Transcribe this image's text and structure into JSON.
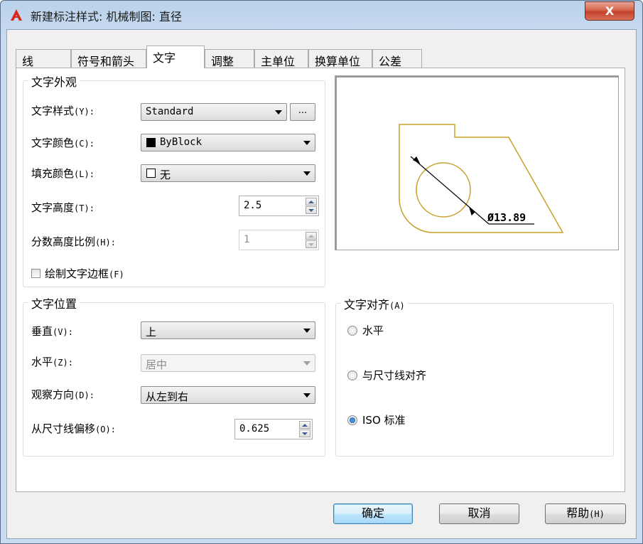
{
  "window": {
    "title": "新建标注样式: 机械制图: 直径",
    "close_label": "X"
  },
  "tabs": [
    {
      "label": "线"
    },
    {
      "label": "符号和箭头"
    },
    {
      "label": "文字"
    },
    {
      "label": "调整"
    },
    {
      "label": "主单位"
    },
    {
      "label": "换算单位"
    },
    {
      "label": "公差"
    }
  ],
  "active_tab": "文字",
  "text_appearance": {
    "title": "文字外观",
    "style_label": "文字样式",
    "style_key": "(Y):",
    "style_value": "Standard",
    "style_browse": "...",
    "color_label": "文字颜色",
    "color_key": "(C):",
    "color_value": "ByBlock",
    "fill_label": "填充颜色",
    "fill_key": "(L):",
    "fill_value": "无",
    "height_label": "文字高度",
    "height_key": "(T):",
    "height_value": "2.5",
    "fraction_label": "分数高度比例",
    "fraction_key": "(H):",
    "fraction_value": "1",
    "frame_label": "绘制文字边框",
    "frame_key": "(F)",
    "frame_checked": false
  },
  "text_placement": {
    "title": "文字位置",
    "vertical_label": "垂直",
    "vertical_key": "(V):",
    "vertical_value": "上",
    "horizontal_label": "水平",
    "horizontal_key": "(Z):",
    "horizontal_value": "居中",
    "view_dir_label": "观察方向",
    "view_dir_key": "(D):",
    "view_dir_value": "从左到右",
    "offset_label": "从尺寸线偏移",
    "offset_key": "(O):",
    "offset_value": "0.625"
  },
  "text_alignment": {
    "title": "文字对齐",
    "title_key": "(A)",
    "options": [
      {
        "label": "水平",
        "selected": false
      },
      {
        "label": "与尺寸线对齐",
        "selected": false
      },
      {
        "label": "ISO 标准",
        "selected": true
      }
    ]
  },
  "preview": {
    "dimension_text": "Ø13.89",
    "line_color": "#c8a02a"
  },
  "buttons": {
    "ok": "确定",
    "cancel": "取消",
    "help": "帮助",
    "help_key": "(H)"
  },
  "colors": {
    "accent": "#3c7fb1",
    "title_gradient": "#b9d1ea",
    "close_red": "#c4412a"
  }
}
